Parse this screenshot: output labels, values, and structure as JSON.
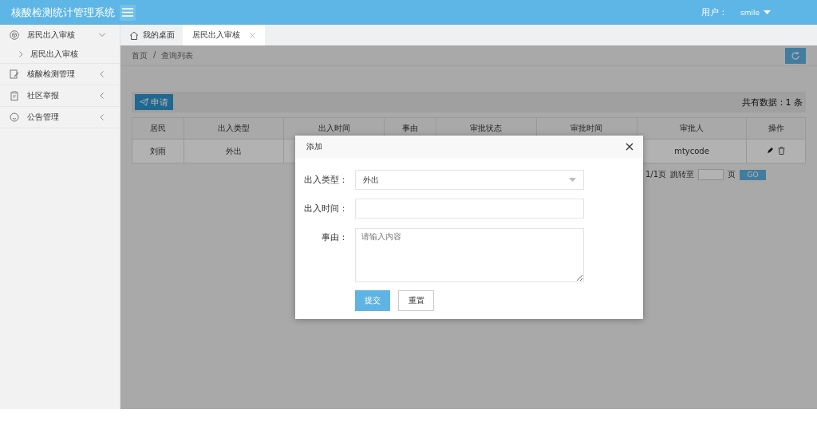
{
  "app_title": "核酸检测统计管理系统",
  "user": {
    "label": "用户：",
    "name": "smile"
  },
  "sidebar": [
    {
      "label": "居民出入审核",
      "expanded": true,
      "children": [
        {
          "label": "居民出入审核"
        }
      ]
    },
    {
      "label": "核酸检测管理",
      "expanded": false
    },
    {
      "label": "社区举报",
      "expanded": false
    },
    {
      "label": "公告管理",
      "expanded": false
    }
  ],
  "tabs": [
    {
      "label": "我的桌面",
      "kind": "home",
      "selected": false
    },
    {
      "label": "居民出入审核",
      "kind": "closable",
      "selected": true
    }
  ],
  "breadcrumb": [
    "首页",
    "/",
    "查询列表"
  ],
  "apply_button": "申请",
  "total": "共有数据：1 条",
  "table": {
    "columns": [
      "居民",
      "出入类型",
      "出入时间",
      "事由",
      "审批状态",
      "审批时间",
      "审批人",
      "操作"
    ],
    "rows": [
      {
        "cells": [
          "刘雨",
          "外出",
          "",
          "",
          "",
          "",
          "mtycode",
          ""
        ]
      }
    ]
  },
  "pager": {
    "pages": "1/1页",
    "jump": "跳转至",
    "unit": "页",
    "go": "GO"
  },
  "dialog": {
    "title": "添加",
    "fields": [
      {
        "label": "出入类型：",
        "kind": "select",
        "value": "外出"
      },
      {
        "label": "出入时间：",
        "kind": "input"
      },
      {
        "label": "事由：",
        "kind": "textarea",
        "placeholder": "请输入内容"
      }
    ],
    "submit": "提交",
    "reset": "重置"
  }
}
